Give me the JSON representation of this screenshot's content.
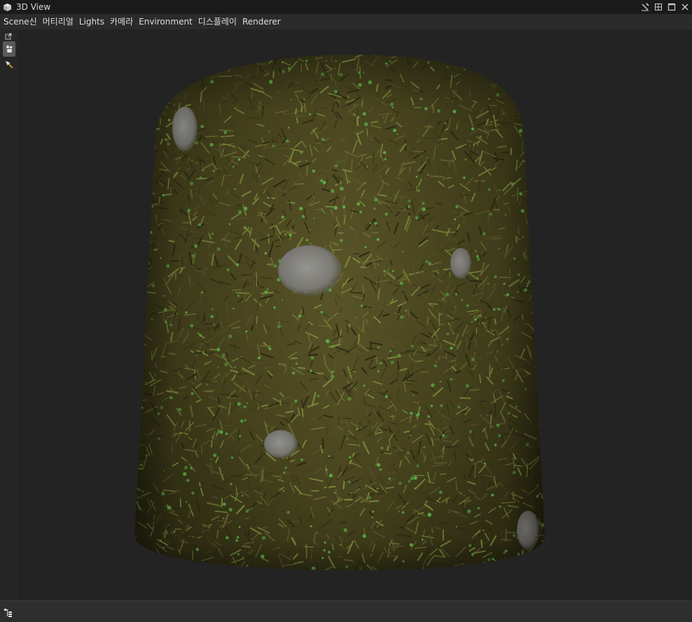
{
  "window": {
    "title": "3D View",
    "icon": "cube-icon",
    "controls": [
      "pin-icon",
      "tile-icon",
      "maximize-icon",
      "close-icon"
    ]
  },
  "menu": {
    "items": [
      "Scene신",
      "머티리얼",
      "Lights",
      "카메라",
      "Environment",
      "디스플레이",
      "Renderer"
    ]
  },
  "toolbar": {
    "tools": [
      "detach-icon",
      "move-icon",
      "select-icon"
    ],
    "active_tool": "move-icon"
  },
  "viewport": {
    "object": "cylinder",
    "material": "grass-moss-rock",
    "background_color": "#232323"
  },
  "status": {
    "icon": "scene-tree-icon"
  },
  "colors": {
    "grass_dark": "#2f2e14",
    "grass_mid": "#57552a",
    "grass_light": "#7a8a3a",
    "clover_green": "#5eb84a",
    "rock_gray": "#8a8985"
  }
}
